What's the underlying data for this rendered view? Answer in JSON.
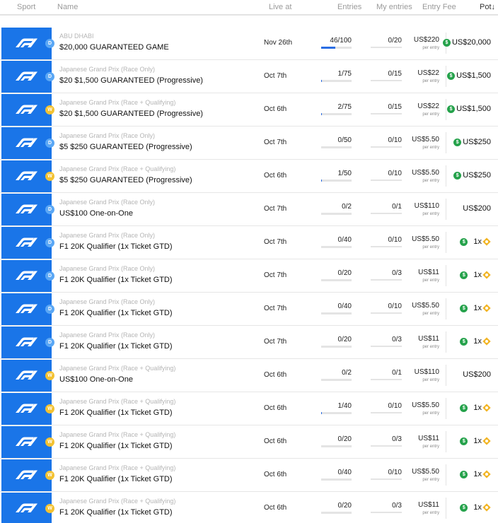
{
  "header": {
    "sport": "Sport",
    "name": "Name",
    "live_at": "Live at",
    "entries": "Entries",
    "my_entries": "My entries",
    "entry_fee": "Entry Fee",
    "pot": "Pot",
    "pot_sort_arrow": "↓"
  },
  "colors": {
    "sport_tile": "#1a75e8",
    "tier_d": "#5aa7f5",
    "tier_w": "#f3c232",
    "progress": "#2a6de3",
    "coin": "#25a24b",
    "ticket": "#f2b526"
  },
  "per_entry_label": "per entry",
  "contests": [
    {
      "tier": "D",
      "subtitle": "ABU DHABI",
      "title": "$20,000 GUARANTEED GAME",
      "live": "Nov 26th",
      "entries": "46/100",
      "entries_fill": 0.46,
      "my": "0/20",
      "fee": "US$220",
      "pot_type": "money",
      "pot": "US$20,000"
    },
    {
      "tier": "D",
      "subtitle": "Japanese Grand Prix (Race Only)",
      "title": "$20 $1,500 GUARANTEED (Progressive)",
      "live": "Oct 7th",
      "entries": "1/75",
      "entries_fill": 0.013,
      "my": "0/15",
      "fee": "US$22",
      "pot_type": "money",
      "pot": "US$1,500"
    },
    {
      "tier": "W",
      "subtitle": "Japanese Grand Prix (Race + Qualifying)",
      "title": "$20 $1,500 GUARANTEED (Progressive)",
      "live": "Oct 6th",
      "entries": "2/75",
      "entries_fill": 0.027,
      "my": "0/15",
      "fee": "US$22",
      "pot_type": "money",
      "pot": "US$1,500"
    },
    {
      "tier": "D",
      "subtitle": "Japanese Grand Prix (Race Only)",
      "title": "$5 $250 GUARANTEED (Progressive)",
      "live": "Oct 7th",
      "entries": "0/50",
      "entries_fill": 0,
      "my": "0/10",
      "fee": "US$5.50",
      "pot_type": "money",
      "pot": "US$250"
    },
    {
      "tier": "W",
      "subtitle": "Japanese Grand Prix (Race + Qualifying)",
      "title": "$5 $250 GUARANTEED (Progressive)",
      "live": "Oct 6th",
      "entries": "1/50",
      "entries_fill": 0.02,
      "my": "0/10",
      "fee": "US$5.50",
      "pot_type": "money",
      "pot": "US$250"
    },
    {
      "tier": "D",
      "subtitle": "Japanese Grand Prix (Race Only)",
      "title": "US$100 One-on-One",
      "live": "Oct 7th",
      "entries": "0/2",
      "entries_fill": 0,
      "my": "0/1",
      "fee": "US$110",
      "pot_type": "plain",
      "pot": "US$200"
    },
    {
      "tier": "D",
      "subtitle": "Japanese Grand Prix (Race Only)",
      "title": "F1 20K Qualifier (1x Ticket GTD)",
      "live": "Oct 7th",
      "entries": "0/40",
      "entries_fill": 0,
      "my": "0/10",
      "fee": "US$5.50",
      "pot_type": "ticket",
      "pot": "1x"
    },
    {
      "tier": "D",
      "subtitle": "Japanese Grand Prix (Race Only)",
      "title": "F1 20K Qualifier (1x Ticket GTD)",
      "live": "Oct 7th",
      "entries": "0/20",
      "entries_fill": 0,
      "my": "0/3",
      "fee": "US$11",
      "pot_type": "ticket",
      "pot": "1x"
    },
    {
      "tier": "D",
      "subtitle": "Japanese Grand Prix (Race Only)",
      "title": "F1 20K Qualifier (1x Ticket GTD)",
      "live": "Oct 7th",
      "entries": "0/40",
      "entries_fill": 0,
      "my": "0/10",
      "fee": "US$5.50",
      "pot_type": "ticket",
      "pot": "1x"
    },
    {
      "tier": "D",
      "subtitle": "Japanese Grand Prix (Race Only)",
      "title": "F1 20K Qualifier (1x Ticket GTD)",
      "live": "Oct 7th",
      "entries": "0/20",
      "entries_fill": 0,
      "my": "0/3",
      "fee": "US$11",
      "pot_type": "ticket",
      "pot": "1x"
    },
    {
      "tier": "W",
      "subtitle": "Japanese Grand Prix (Race + Qualifying)",
      "title": "US$100 One-on-One",
      "live": "Oct 6th",
      "entries": "0/2",
      "entries_fill": 0,
      "my": "0/1",
      "fee": "US$110",
      "pot_type": "plain",
      "pot": "US$200"
    },
    {
      "tier": "W",
      "subtitle": "Japanese Grand Prix (Race + Qualifying)",
      "title": "F1 20K Qualifier (1x Ticket GTD)",
      "live": "Oct 6th",
      "entries": "1/40",
      "entries_fill": 0.025,
      "my": "0/10",
      "fee": "US$5.50",
      "pot_type": "ticket",
      "pot": "1x"
    },
    {
      "tier": "W",
      "subtitle": "Japanese Grand Prix (Race + Qualifying)",
      "title": "F1 20K Qualifier (1x Ticket GTD)",
      "live": "Oct 6th",
      "entries": "0/20",
      "entries_fill": 0,
      "my": "0/3",
      "fee": "US$11",
      "pot_type": "ticket",
      "pot": "1x"
    },
    {
      "tier": "W",
      "subtitle": "Japanese Grand Prix (Race + Qualifying)",
      "title": "F1 20K Qualifier (1x Ticket GTD)",
      "live": "Oct 6th",
      "entries": "0/40",
      "entries_fill": 0,
      "my": "0/10",
      "fee": "US$5.50",
      "pot_type": "ticket",
      "pot": "1x"
    },
    {
      "tier": "W",
      "subtitle": "Japanese Grand Prix (Race + Qualifying)",
      "title": "F1 20K Qualifier (1x Ticket GTD)",
      "live": "Oct 6th",
      "entries": "0/20",
      "entries_fill": 0,
      "my": "0/3",
      "fee": "US$11",
      "pot_type": "ticket",
      "pot": "1x"
    }
  ]
}
